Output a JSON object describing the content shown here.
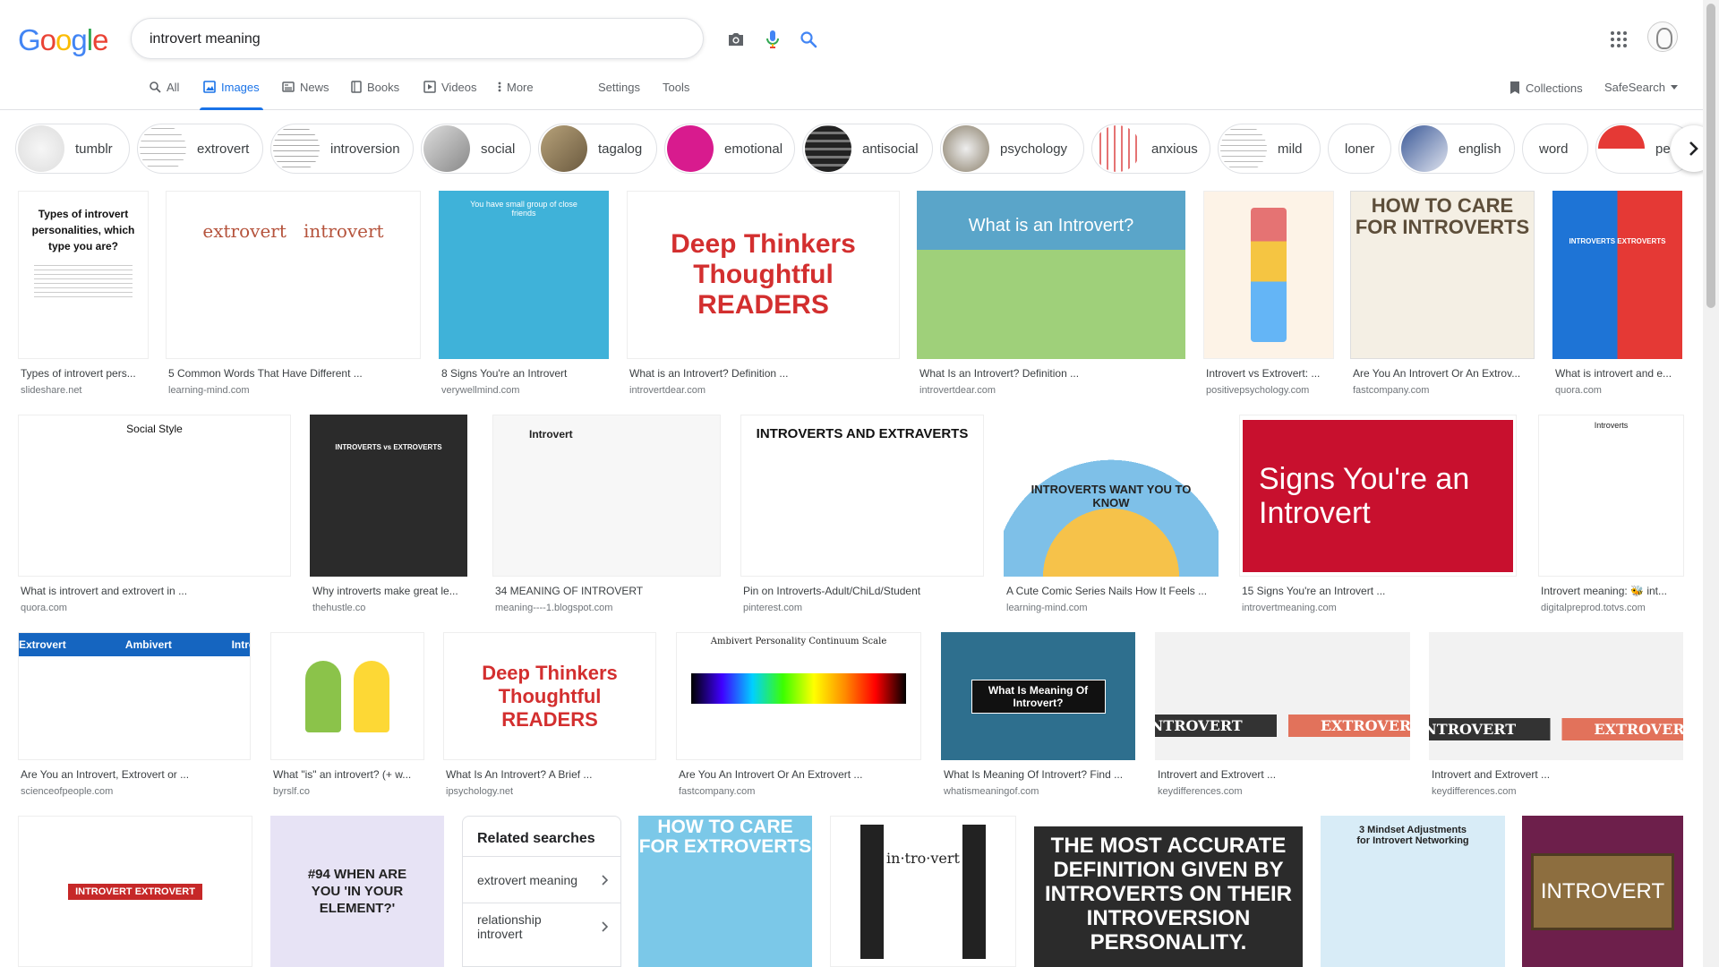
{
  "logo": [
    "G",
    "o",
    "o",
    "g",
    "l",
    "e"
  ],
  "search": {
    "query": "introvert meaning",
    "placeholder": ""
  },
  "tabs": [
    {
      "label": "All",
      "icon": "search-icon"
    },
    {
      "label": "Images",
      "icon": "image-icon",
      "active": true
    },
    {
      "label": "News",
      "icon": "news-icon"
    },
    {
      "label": "Books",
      "icon": "book-icon"
    },
    {
      "label": "Videos",
      "icon": "video-icon"
    },
    {
      "label": "More",
      "icon": "more-vert-icon"
    }
  ],
  "tools": {
    "settings": "Settings",
    "tools": "Tools"
  },
  "right": {
    "collections": "Collections",
    "safesearch": "SafeSearch"
  },
  "chips": [
    {
      "label": "tumblr"
    },
    {
      "label": "extrovert"
    },
    {
      "label": "introversion"
    },
    {
      "label": "social"
    },
    {
      "label": "tagalog"
    },
    {
      "label": "emotional"
    },
    {
      "label": "antisocial"
    },
    {
      "label": "psychology"
    },
    {
      "label": "anxious"
    },
    {
      "label": "mild"
    },
    {
      "label": "loner"
    },
    {
      "label": "english"
    },
    {
      "label": "word"
    },
    {
      "label": "pe"
    }
  ],
  "results": [
    {
      "caption": "Types of introvert pers...",
      "source": "slideshare.net",
      "img_text": "Types of introvert personalities, which type you are?"
    },
    {
      "caption": "5 Common Words That Have Different ...",
      "source": "learning-mind.com",
      "img_text": "extrovert   introvert"
    },
    {
      "caption": "8 Signs You're an Introvert",
      "source": "verywellmind.com",
      "img_text": "You have small group of close friends"
    },
    {
      "caption": "What is an Introvert? Definition ...",
      "source": "introvertdear.com",
      "img_text": "Deep Thinkers Thoughtful READERS"
    },
    {
      "caption": "What Is an Introvert? Definition ...",
      "source": "introvertdear.com",
      "img_text": "What is an Introvert?"
    },
    {
      "caption": "Introvert vs Extrovert: ...",
      "source": "positivepsychology.com",
      "img_text": ""
    },
    {
      "caption": "Are You An Introvert Or An Extrov...",
      "source": "fastcompany.com",
      "img_text": "HOW TO CARE FOR INTROVERTS"
    },
    {
      "caption": "What is introvert and e...",
      "source": "quora.com",
      "img_text": "INTROVERTS EXTROVERTS"
    },
    {
      "caption": "What is introvert and extrovert in ...",
      "source": "quora.com",
      "img_text": "Social Style"
    },
    {
      "caption": "Why introverts make great le...",
      "source": "thehustle.co",
      "img_text": "INTROVERTS vs EXTROVERTS"
    },
    {
      "caption": "34 MEANING OF INTROVERT",
      "source": "meaning----1.blogspot.com",
      "img_text": "Introvert"
    },
    {
      "caption": "Pin on Introverts-Adult/ChiLd/Student",
      "source": "pinterest.com",
      "img_text": "INTROVERTS AND EXTRAVERTS"
    },
    {
      "caption": "A Cute Comic Series Nails How It Feels ...",
      "source": "learning-mind.com",
      "img_text": "INTROVERTS WANT YOU TO KNOW"
    },
    {
      "caption": "15 Signs You're an Introvert ...",
      "source": "introvertmeaning.com",
      "img_text": "Signs You're an Introvert"
    },
    {
      "caption": "Introvert meaning: 🐝 int...",
      "source": "digitalpreprod.totvs.com",
      "img_text": "Introverts"
    },
    {
      "caption": "Are You an Introvert, Extrovert or ...",
      "source": "scienceofpeople.com",
      "img_text": "Extrovert  Ambivert  Introvert"
    },
    {
      "caption": "What \"is\" an introvert? (+ w...",
      "source": "byrslf.co",
      "img_text": ""
    },
    {
      "caption": "What Is An Introvert? A Brief ...",
      "source": "ipsychology.net",
      "img_text": "Deep Thinkers Thoughtful READERS"
    },
    {
      "caption": "Are You An Introvert Or An Extrovert ...",
      "source": "fastcompany.com",
      "img_text": "Ambivert Personality Continuum Scale"
    },
    {
      "caption": "What Is Meaning Of Introvert? Find ...",
      "source": "whatismeaningof.com",
      "img_text": "What Is Meaning Of Introvert?"
    },
    {
      "caption": "Introvert and Extrovert ...",
      "source": "keydifferences.com",
      "img_text": "INTROVERT  EXTROVERT"
    },
    {
      "caption": "Introvert and Extrovert ...",
      "source": "keydifferences.com",
      "img_text": "INTROVERT  EXTROVERT"
    },
    {
      "caption": "",
      "source": "",
      "img_text": "INTROVERT EXTROVERT"
    },
    {
      "caption": "",
      "source": "",
      "img_text": "#94 WHEN ARE YOU 'IN YOUR ELEMENT?'"
    },
    {
      "caption": "",
      "source": "",
      "img_text": "HOW TO CARE FOR EXTROVERTS"
    },
    {
      "caption": "",
      "source": "",
      "img_text": "in·tro·vert"
    },
    {
      "caption": "",
      "source": "",
      "img_text": "THE MOST ACCURATE DEFINITION GIVEN BY INTROVERTS ON THEIR INTROVERSION PERSONALITY."
    },
    {
      "caption": "",
      "source": "",
      "img_text": "3 Mindset Adjustments for Introvert Networking"
    },
    {
      "caption": "",
      "source": "",
      "img_text": "INTROVERT"
    }
  ],
  "related": {
    "title": "Related searches",
    "items": [
      "extrovert meaning",
      "relationship introvert"
    ]
  },
  "colors": {
    "accent": "#1a73e8",
    "border": "#dfe1e5",
    "text_muted": "#70757a"
  }
}
